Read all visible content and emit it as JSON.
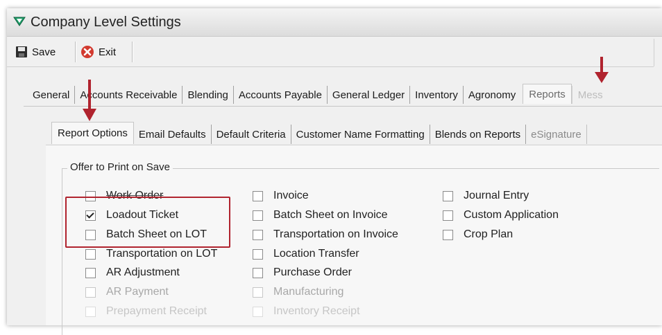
{
  "window": {
    "title": "Company Level Settings",
    "icon": "green-triangle-icon"
  },
  "toolbar": {
    "save_label": "Save",
    "save_icon": "floppy-disk-icon",
    "exit_label": "Exit",
    "exit_icon": "red-x-circle-icon"
  },
  "main_tabs": [
    {
      "label": "General"
    },
    {
      "label": "Accounts Receivable"
    },
    {
      "label": "Blending"
    },
    {
      "label": "Accounts Payable"
    },
    {
      "label": "General Ledger"
    },
    {
      "label": "Inventory"
    },
    {
      "label": "Agronomy"
    },
    {
      "label": "Reports",
      "active": true
    },
    {
      "label": "Mess"
    }
  ],
  "report_tabs": [
    {
      "label": "Report Options",
      "active": true
    },
    {
      "label": "Email Defaults"
    },
    {
      "label": "Default Criteria"
    },
    {
      "label": "Customer Name Formatting"
    },
    {
      "label": "Blends on Reports"
    },
    {
      "label": "eSignature"
    }
  ],
  "group": {
    "label": "Offer to Print on Save",
    "columns": [
      [
        {
          "label": "Work Order",
          "checked": false,
          "state": "strikethrough"
        },
        {
          "label": "Loadout Ticket",
          "checked": true
        },
        {
          "label": "Batch Sheet on LOT",
          "checked": false
        },
        {
          "label": "Transportation on LOT",
          "checked": false
        },
        {
          "label": "AR Adjustment",
          "checked": false
        },
        {
          "label": "AR Payment",
          "checked": false,
          "state": "disabled"
        },
        {
          "label": "Prepayment Receipt",
          "checked": false,
          "state": "faint"
        }
      ],
      [
        {
          "label": "Invoice",
          "checked": false
        },
        {
          "label": "Batch Sheet on Invoice",
          "checked": false
        },
        {
          "label": "Transportation on Invoice",
          "checked": false
        },
        {
          "label": "Location Transfer",
          "checked": false
        },
        {
          "label": "Purchase Order",
          "checked": false
        },
        {
          "label": "Manufacturing",
          "checked": false,
          "state": "disabled"
        },
        {
          "label": "Inventory Receipt",
          "checked": false,
          "state": "faint"
        }
      ],
      [
        {
          "label": "Journal Entry",
          "checked": false
        },
        {
          "label": "Custom Application",
          "checked": false
        },
        {
          "label": "Crop Plan",
          "checked": false
        }
      ]
    ]
  },
  "colors": {
    "annotation_red": "#b0232e",
    "highlight_border": "#b0232e"
  }
}
